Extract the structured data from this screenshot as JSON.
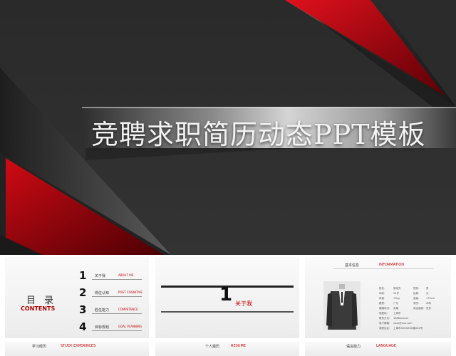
{
  "hero": {
    "title": "竞聘求职简历动态PPT模板",
    "colors": {
      "background": "#2e2e2e",
      "accent": "#b0000c",
      "band": "#c9c9c9"
    }
  },
  "slide_toc": {
    "title": "目 录",
    "subtitle": "CONTENTS",
    "items": [
      {
        "num": "1",
        "label": "关于我",
        "en": "ABOUT ME"
      },
      {
        "num": "2",
        "label": "岗位认知",
        "en": "POST COGNITIVE"
      },
      {
        "num": "3",
        "label": "胜任能力",
        "en": "COMPETENCE"
      },
      {
        "num": "4",
        "label": "目标规划",
        "en": "GOAL PLANNING"
      }
    ]
  },
  "slide_section": {
    "num": "1",
    "title": "关于我"
  },
  "slide_info": {
    "header": "基本信息",
    "header_en": "INFORMATION",
    "rows": [
      [
        "姓名：",
        "张晓先",
        "性别：",
        "男"
      ],
      [
        "年龄：",
        "24岁",
        "民族：",
        "汉"
      ],
      [
        "体重：",
        "70kg",
        "身高：",
        "175cm"
      ],
      [
        "籍贯：",
        "广东",
        "学历：",
        "本科"
      ],
      [
        "婚姻状况：",
        "未婚",
        "政治面貌：",
        "党员"
      ],
      [
        "现居地：",
        "上海市",
        "",
        ""
      ],
      [
        "联系方式：",
        "1888xxxxxx",
        "",
        ""
      ],
      [
        "电子邮箱：",
        "xxxx@xxx.com",
        "",
        ""
      ],
      [
        "家庭住址：",
        "上海市XXXXXXX路XXX号",
        "",
        ""
      ]
    ]
  },
  "bottom": {
    "left": {
      "label": "学习经历",
      "en": "STUDY EXPERINCES"
    },
    "middle": {
      "label": "个人履历",
      "en": "RESUME"
    },
    "right": {
      "label": "语言能力",
      "en": "LANGUAGE"
    }
  }
}
